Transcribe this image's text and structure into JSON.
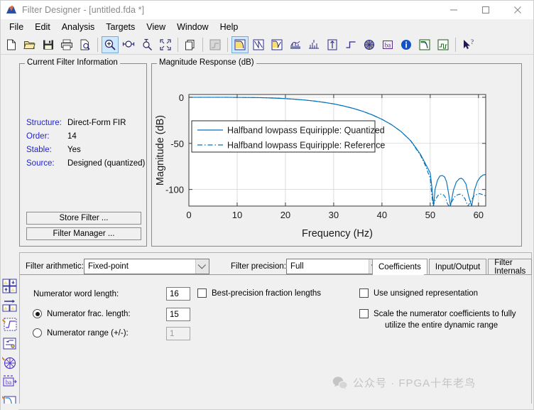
{
  "window": {
    "title": "Filter Designer -  [untitled.fda *]",
    "icon": "matlab-wave-icon",
    "buttons": [
      {
        "name": "minimize-button",
        "glyph": "minimize-icon"
      },
      {
        "name": "maximize-button",
        "glyph": "maximize-icon"
      },
      {
        "name": "close-button",
        "glyph": "close-icon"
      }
    ]
  },
  "menubar": {
    "items": [
      "File",
      "Edit",
      "Analysis",
      "Targets",
      "View",
      "Window",
      "Help"
    ]
  },
  "toolbar": {
    "groups": [
      [
        "new-file-icon",
        "open-folder-icon",
        "save-disk-icon",
        "print-icon",
        "print-preview-icon"
      ],
      [
        "zoom-in-icon",
        "zoom-x-icon",
        "zoom-y-icon",
        "zoom-fit-icon"
      ],
      [
        "copy-icon"
      ],
      [
        "filter-spec-icon"
      ],
      [
        "magnitude-response-icon",
        "phase-response-icon",
        "magnitude-phase-icon",
        "group-delay-icon",
        "phase-delay-icon",
        "impulse-response-icon",
        "step-response-icon",
        "pole-zero-icon",
        "filter-coefficients-icon",
        "filter-information-icon",
        "magnitude-estimate-icon",
        "round-off-noise-icon"
      ],
      [
        "context-help-icon"
      ]
    ],
    "selected": [
      "zoom-in-icon",
      "magnitude-response-icon"
    ]
  },
  "sidestrip": {
    "items": [
      "import-export-icon",
      "transform-arrow-icon",
      "design-filter-icon",
      "realize-model-icon",
      "pole-zero-editor-icon",
      "set-quantization-icon",
      "digital-filter-icon"
    ]
  },
  "current_filter_information": {
    "title": "Current Filter Information",
    "fields": [
      {
        "label": "Structure:",
        "value": "Direct-Form FIR"
      },
      {
        "label": "Order:",
        "value": "14"
      },
      {
        "label": "Stable:",
        "value": "Yes"
      },
      {
        "label": "Source:",
        "value": "Designed (quantized)"
      }
    ],
    "store_filter_label": "Store Filter ...",
    "filter_manager_label": "Filter Manager ..."
  },
  "magnitude_group": {
    "title": "Magnitude Response (dB)"
  },
  "chart_data": {
    "type": "line",
    "title": "Magnitude Response (dB)",
    "xlabel": "Frequency (Hz)",
    "ylabel": "Magnitude (dB)",
    "xlim": [
      0,
      61.5
    ],
    "ylim": [
      -118,
      3
    ],
    "xticks": [
      0,
      10,
      20,
      30,
      40,
      50,
      60
    ],
    "yticks": [
      0,
      -50,
      -100
    ],
    "grid": true,
    "legend_position": "center-left",
    "line_color": "#0072BD",
    "series": [
      {
        "name": "Halfband lowpass Equiripple: Quantized",
        "style": "solid",
        "x": [
          0,
          2,
          4,
          6,
          8,
          10,
          12,
          14,
          16,
          18,
          20,
          22,
          24,
          26,
          28,
          30,
          32,
          34,
          36,
          38,
          40,
          42,
          44,
          46,
          48,
          49,
          50,
          50.4,
          50.7,
          51,
          51.5,
          52,
          52.5,
          53,
          53.4,
          53.8,
          54.2,
          54.8,
          55.4,
          56,
          56.4,
          56.8,
          57.4,
          58,
          58.6,
          59.2,
          59.8,
          60.4,
          61,
          61.5
        ],
        "y": [
          0,
          0,
          -0.01,
          -0.02,
          -0.05,
          -0.1,
          -0.2,
          -0.35,
          -0.6,
          -0.95,
          -1.45,
          -2.1,
          -3.0,
          -4.1,
          -5.5,
          -7.2,
          -9.4,
          -12.0,
          -15.2,
          -19.1,
          -23.9,
          -29.8,
          -37.3,
          -47.3,
          -62.0,
          -72.0,
          -82.0,
          -100.0,
          -118.0,
          -100.0,
          -90.0,
          -85.5,
          -84.8,
          -86.5,
          -92.0,
          -104.0,
          -118.0,
          -101.0,
          -92.0,
          -88.5,
          -87.8,
          -89.0,
          -94.0,
          -108.0,
          -118.0,
          -100.0,
          -91.0,
          -86.5,
          -84.2,
          -83.8
        ]
      },
      {
        "name": "Halfband lowpass Equiripple: Reference",
        "style": "dash-dot",
        "x": [
          0,
          2,
          4,
          6,
          8,
          10,
          12,
          14,
          16,
          18,
          20,
          22,
          24,
          26,
          28,
          30,
          32,
          34,
          36,
          38,
          40,
          42,
          44,
          46,
          48,
          49,
          50,
          50.3,
          50.6,
          51,
          51.6,
          52.2,
          52.8,
          53.2,
          53.6,
          54,
          54.6,
          55.2,
          55.8,
          56.2,
          56.6,
          57.2,
          57.8,
          58.4,
          59,
          59.6,
          60.2,
          60.8,
          61.5
        ],
        "y": [
          0,
          0,
          -0.01,
          -0.02,
          -0.05,
          -0.1,
          -0.2,
          -0.35,
          -0.6,
          -0.95,
          -1.45,
          -2.1,
          -3.0,
          -4.1,
          -5.5,
          -7.2,
          -9.4,
          -12.0,
          -15.2,
          -19.1,
          -23.9,
          -29.8,
          -37.3,
          -47.6,
          -63.0,
          -74.0,
          -88.0,
          -105.0,
          -118.0,
          -112.0,
          -106.5,
          -105.0,
          -106.0,
          -109.0,
          -116.0,
          -118.0,
          -112.0,
          -107.0,
          -105.5,
          -105.0,
          -106.0,
          -110.0,
          -118.0,
          -113.0,
          -107.5,
          -105.5,
          -104.5,
          -105.5,
          -107.0
        ]
      }
    ]
  },
  "bottom_panel": {
    "filter_arithmetic_label": "Filter arithmetic:",
    "filter_arithmetic_value": "Fixed-point",
    "filter_precision_label": "Filter precision:",
    "filter_precision_value": "Full",
    "tabs": [
      {
        "label": "Coefficients",
        "active": true
      },
      {
        "label": "Input/Output",
        "active": false
      },
      {
        "label": "Filter Internals",
        "active": false
      }
    ],
    "numerator_word_length_label": "Numerator word length:",
    "numerator_word_length_value": "16",
    "best_precision_label": "Best-precision fraction lengths",
    "best_precision_checked": false,
    "numerator_frac_length_label": "Numerator frac. length:",
    "numerator_frac_length_value": "15",
    "numerator_frac_length_selected": true,
    "numerator_range_label": "Numerator range (+/-):",
    "numerator_range_value": "1",
    "numerator_range_selected": false,
    "use_unsigned_label": "Use unsigned representation",
    "use_unsigned_checked": false,
    "scale_numerator_line1": "Scale the numerator coefficients to fully",
    "scale_numerator_line2": "utilize the entire dynamic range",
    "scale_numerator_checked": false
  },
  "watermark": {
    "icon": "wechat-icon",
    "text": "公众号 · FPGA十年老鸟",
    "color": "#c4c4c4"
  }
}
